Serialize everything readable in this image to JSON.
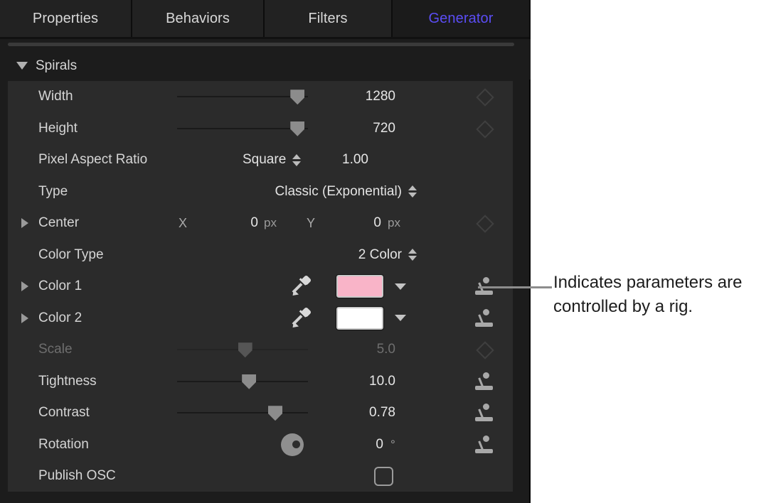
{
  "tabs": [
    {
      "label": "Properties",
      "active": false
    },
    {
      "label": "Behaviors",
      "active": false
    },
    {
      "label": "Filters",
      "active": false
    },
    {
      "label": "Generator",
      "active": true
    }
  ],
  "accent_color": "#5b4df5",
  "group": {
    "title": "Spirals",
    "expanded": true
  },
  "rows": [
    {
      "name": "width",
      "label": "Width",
      "control": "slider",
      "slider_pct": 92,
      "value": "1280",
      "unit": "",
      "right": "keyframe",
      "dim": false,
      "disclosure": false
    },
    {
      "name": "height",
      "label": "Height",
      "control": "slider",
      "slider_pct": 92,
      "value": "720",
      "unit": "",
      "right": "keyframe",
      "dim": false,
      "disclosure": false
    },
    {
      "name": "pixel-aspect-ratio",
      "label": "Pixel Aspect Ratio",
      "control": "popup-with-value",
      "popup_value": "Square",
      "value": "1.00",
      "unit": "",
      "right": "none",
      "dim": false,
      "disclosure": false
    },
    {
      "name": "type",
      "label": "Type",
      "control": "popup",
      "popup_value": "Classic (Exponential)",
      "value": "",
      "unit": "",
      "right": "none",
      "dim": false,
      "disclosure": false
    },
    {
      "name": "center",
      "label": "Center",
      "control": "xy",
      "x_label": "X",
      "x_value": "0",
      "x_unit": "px",
      "y_label": "Y",
      "y_value": "0",
      "y_unit": "px",
      "right": "keyframe",
      "dim": false,
      "disclosure": true
    },
    {
      "name": "color-type",
      "label": "Color Type",
      "control": "popup",
      "popup_value": "2 Color",
      "value": "",
      "unit": "",
      "right": "none",
      "dim": false,
      "disclosure": false
    },
    {
      "name": "color-1",
      "label": "Color 1",
      "control": "color",
      "swatch": "#f9b4c8",
      "right": "rig",
      "dim": false,
      "disclosure": true
    },
    {
      "name": "color-2",
      "label": "Color 2",
      "control": "color",
      "swatch": "#ffffff",
      "right": "rig",
      "dim": false,
      "disclosure": true
    },
    {
      "name": "scale",
      "label": "Scale",
      "control": "slider",
      "slider_pct": 52,
      "value": "5.0",
      "unit": "",
      "right": "keyframe",
      "dim": true,
      "disclosure": false
    },
    {
      "name": "tightness",
      "label": "Tightness",
      "control": "slider",
      "slider_pct": 55,
      "value": "10.0",
      "unit": "",
      "right": "rig",
      "dim": false,
      "disclosure": false
    },
    {
      "name": "contrast",
      "label": "Contrast",
      "control": "slider",
      "slider_pct": 75,
      "value": "0.78",
      "unit": "",
      "right": "rig",
      "dim": false,
      "disclosure": false
    },
    {
      "name": "rotation",
      "label": "Rotation",
      "control": "dial",
      "value": "0",
      "unit": "°",
      "right": "rig",
      "dim": false,
      "disclosure": false
    },
    {
      "name": "publish-osc",
      "label": "Publish OSC",
      "control": "checkbox",
      "checked": false,
      "right": "none",
      "dim": false,
      "disclosure": false
    }
  ],
  "callout": {
    "text": "Indicates parameters are controlled by a rig."
  }
}
